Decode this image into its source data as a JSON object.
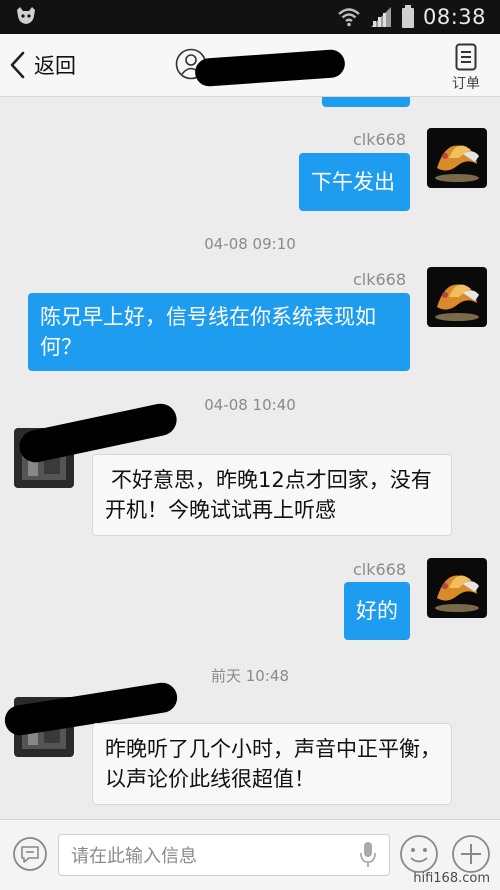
{
  "status_bar": {
    "time": "08:38",
    "icons": [
      "app-icon",
      "wifi-icon",
      "signal-icon",
      "battery-icon"
    ]
  },
  "header": {
    "back_label": "返回",
    "orders_label": "订单"
  },
  "messages": [
    {
      "name": "clk668",
      "text": "下午发出"
    },
    {
      "time": "04-08 09:10"
    },
    {
      "name": "clk668",
      "text": "陈兄早上好，信号线在你系统表现如何？"
    },
    {
      "time": "04-08 10:40"
    },
    {
      "text": "不好意思，昨晚12点才回家，没有开机！今晚试试再上听感"
    },
    {
      "name": "clk668",
      "text": "好的"
    },
    {
      "time": "前天 10:48"
    },
    {
      "text": "昨晚听了几个小时，声音中正平衡，以声论价此线很超值！"
    }
  ],
  "composer": {
    "placeholder": "请在此输入信息"
  },
  "watermark": "hifi168.com",
  "colors": {
    "outgoing_bubble": "#1e9cf0",
    "incoming_bubble": "#f8f8f8",
    "background": "#ececec"
  }
}
